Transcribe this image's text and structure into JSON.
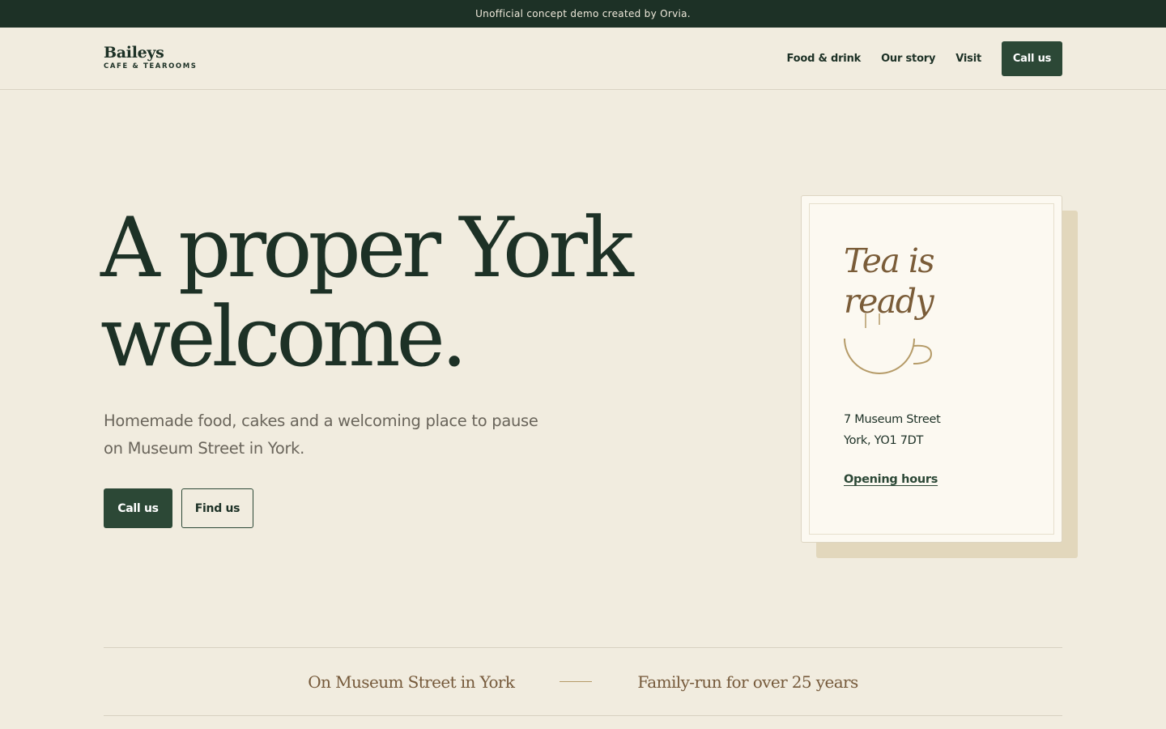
{
  "banner": {
    "text": "Unofficial concept demo created by Orvia."
  },
  "brand": {
    "name": "Baileys",
    "subtitle": "CAFE & TEAROOMS"
  },
  "nav": {
    "items": [
      {
        "label": "Food & drink"
      },
      {
        "label": "Our story"
      },
      {
        "label": "Visit"
      }
    ],
    "cta_label": "Call us"
  },
  "hero": {
    "title_line1": "A proper York",
    "title_line2": "welcome.",
    "subtitle": "Homemade food, cakes and a welcoming place to pause on Museum Street in York.",
    "primary_label": "Call us",
    "secondary_label": "Find us"
  },
  "card": {
    "title_line1": "Tea is",
    "title_line2": "ready",
    "icon": "teacup-icon",
    "address_line1": "7 Museum Street",
    "address_line2": "York, YO1 7DT",
    "link_label": "Opening hours"
  },
  "strip": {
    "left": "On Museum Street in York",
    "right": "Family-run for over 25 years"
  },
  "colors": {
    "background": "#f1ecdf",
    "banner": "#1d3126",
    "primary": "#2c4836",
    "accent": "#7a5c38",
    "card": "#fcf9f1"
  }
}
